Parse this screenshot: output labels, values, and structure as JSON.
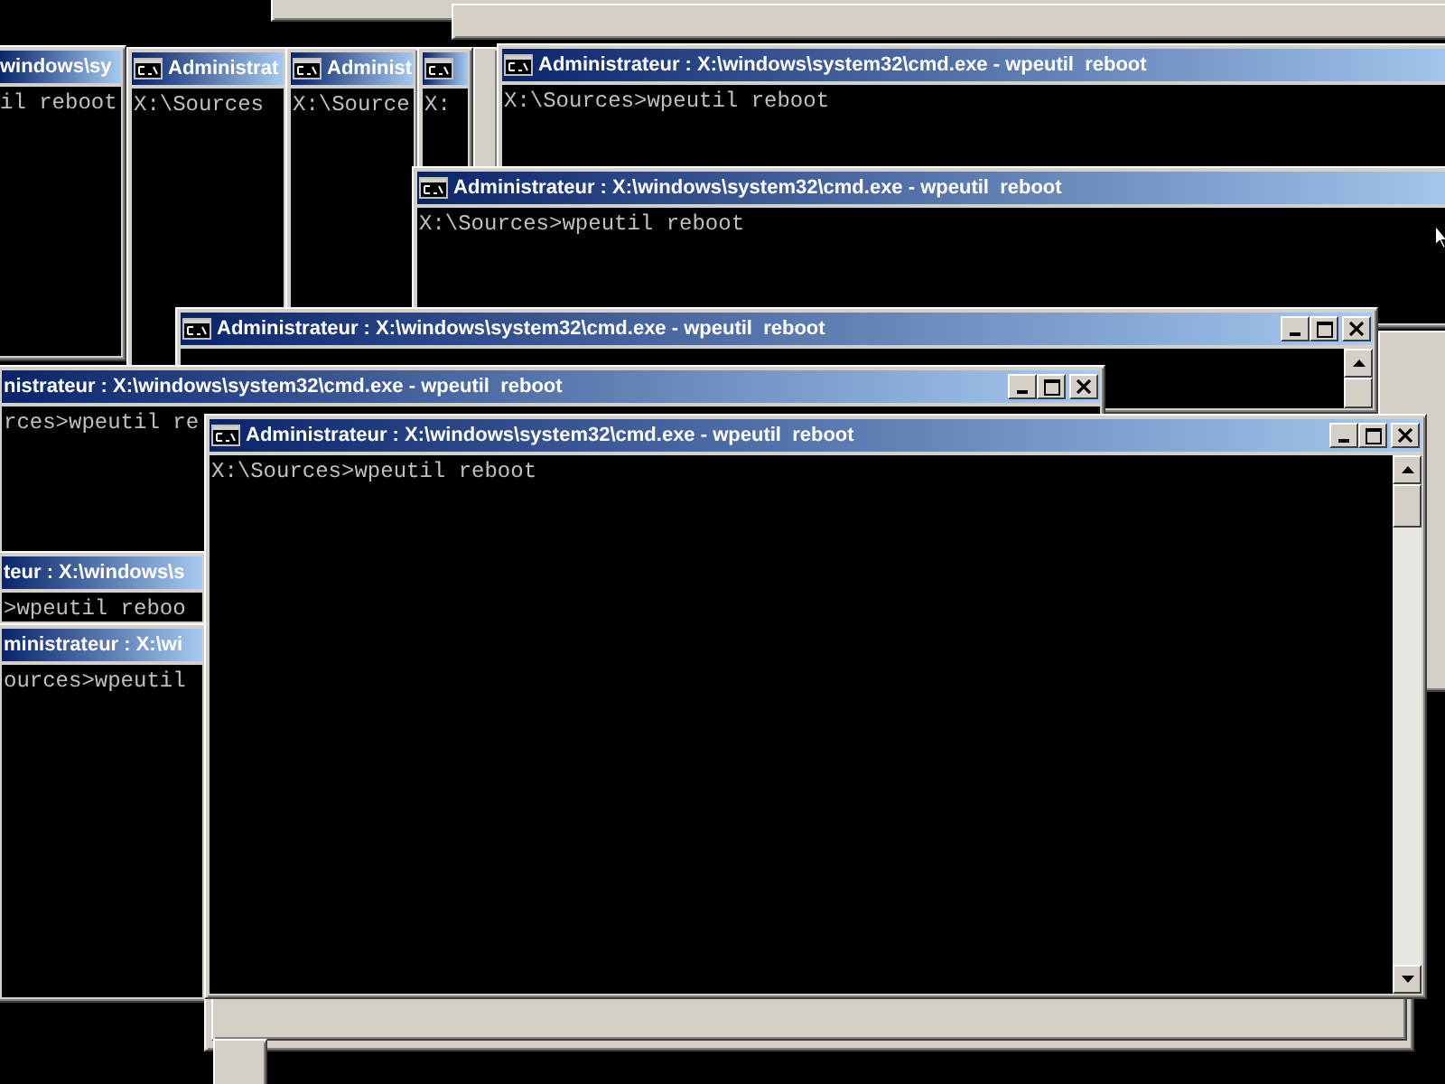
{
  "windows": [
    {
      "title": "windows\\sy",
      "line": "il reboot"
    },
    {
      "title": "Administrat",
      "line": "X:\\Sources"
    },
    {
      "title": "Administ",
      "line": "X:\\Source"
    },
    {
      "line": "X:"
    },
    {
      "title": "Administrateur : X:\\windows\\system32\\cmd.exe - wpeutil  reboot",
      "line": "X:\\Sources>wpeutil reboot"
    },
    {
      "title": "Administrateur : X:\\windows\\system32\\cmd.exe - wpeutil  reboot",
      "line": "X:\\Sources>wpeutil reboot"
    },
    {
      "title": "Administrateur : X:\\windows\\system32\\cmd.exe - wpeutil  reboot"
    },
    {
      "title": "nistrateur : X:\\windows\\system32\\cmd.exe - wpeutil  reboot",
      "line": "rces>wpeutil re"
    },
    {
      "title": "teur : X:\\windows\\s",
      "line": ">wpeutil reboo"
    },
    {
      "title": "ministrateur : X:\\wi",
      "line": "ources>wpeutil"
    },
    {
      "title": "Administrateur : X:\\windows\\system32\\cmd.exe - wpeutil  reboot",
      "line": "X:\\Sources>wpeutil reboot"
    }
  ]
}
